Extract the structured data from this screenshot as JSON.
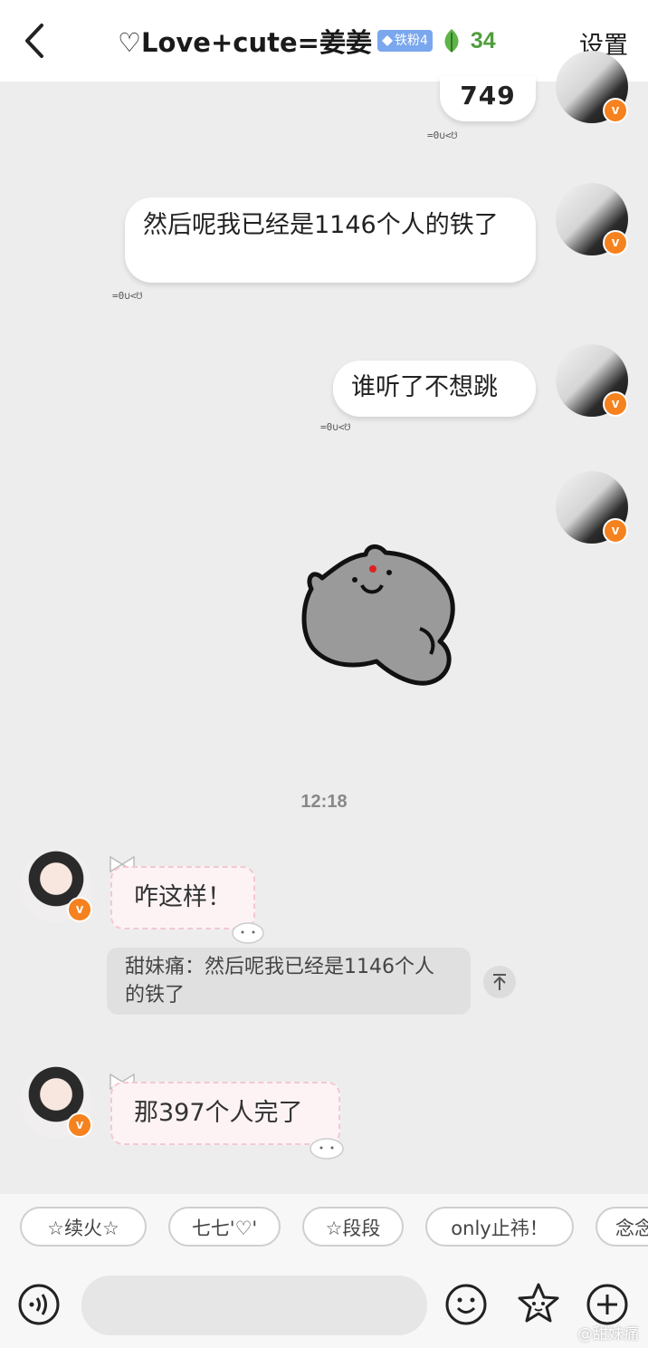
{
  "header": {
    "title": "♡Love+cute=姜姜",
    "fan_badge": "铁粉4",
    "fan_count": "34",
    "settings_label": "设置"
  },
  "messages": {
    "m1": {
      "text": "749",
      "deco": "=0∪<☋"
    },
    "m2": {
      "text": "然后呢我已经是1146个人的铁了",
      "deco": "=0∪<☋"
    },
    "m3": {
      "text": "谁听了不想跳",
      "deco": "=0∪<☋"
    },
    "timestamp": "12:18",
    "m5": {
      "text": "咋这样！"
    },
    "m5_quote": "甜妹痛：然后呢我已经是1146个人的铁了",
    "m6": {
      "text": "那397个人完了"
    }
  },
  "avatar_badge": "v",
  "chips": [
    "☆续火☆",
    "七七'♡'",
    "☆段段",
    "only止祎！",
    "念念"
  ],
  "watermark": "@甜妹痛",
  "colors": {
    "accent_orange": "#f5821f",
    "fan_badge_blue": "#7aa7ee",
    "fan_count_green": "#4f9e3c",
    "page_bg": "#ededed"
  }
}
